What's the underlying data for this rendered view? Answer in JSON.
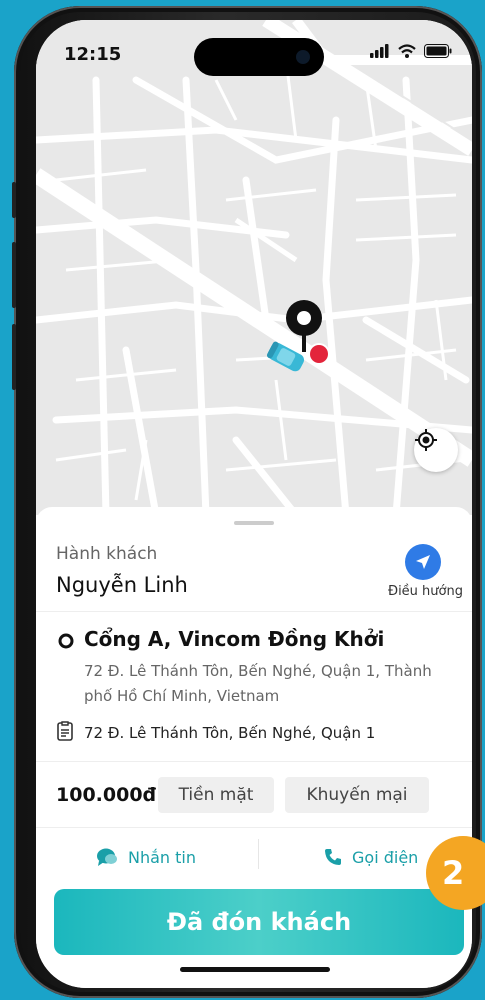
{
  "status_bar": {
    "time": "12:15"
  },
  "map": {
    "icons": [
      "pickup-pin-icon",
      "car-icon",
      "destination-dot-icon",
      "locate-icon"
    ]
  },
  "trip": {
    "passenger_label": "Hành khách",
    "passenger_name": "Nguyễn Linh",
    "navigate_label": "Điều hướng",
    "pickup_title": "Cổng A, Vincom Đồng Khởi",
    "pickup_address": "72 Đ. Lê Thánh Tôn, Bến Nghé, Quận 1, Thành phố Hồ Chí Minh, Vietnam",
    "note": "72 Đ. Lê Thánh Tôn, Bến Nghé, Quận 1",
    "fare": "100.000đ",
    "payment_method": "Tiền mặt",
    "promotion": "Khuyến mại"
  },
  "actions": {
    "message_label": "Nhắn tin",
    "call_label": "Gọi điện"
  },
  "primary_button": "Đã đón khách",
  "step_badge": "2",
  "colors": {
    "accent": "#1bb7bd",
    "navigate": "#2f7be6",
    "badge": "#f4a623",
    "destination": "#e3243b"
  }
}
